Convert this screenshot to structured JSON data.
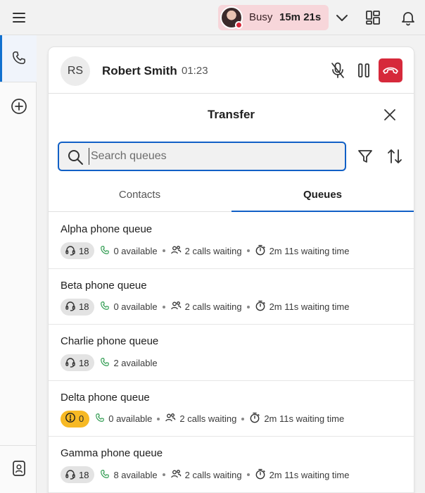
{
  "topbar": {
    "status": {
      "label": "Busy",
      "duration": "15m 21s",
      "color": "#d6293b"
    }
  },
  "call": {
    "initials": "RS",
    "name": "Robert Smith",
    "timer": "01:23"
  },
  "transfer": {
    "title": "Transfer",
    "search_placeholder": "Search queues",
    "tabs": [
      {
        "label": "Contacts",
        "active": false
      },
      {
        "label": "Queues",
        "active": true
      }
    ]
  },
  "queues": [
    {
      "name": "Alpha phone queue",
      "agents": "18",
      "warning": false,
      "available": "0 available",
      "waiting": "2 calls waiting",
      "wait_time": "2m 11s waiting time"
    },
    {
      "name": "Beta phone queue",
      "agents": "18",
      "warning": false,
      "available": "0 available",
      "waiting": "2 calls waiting",
      "wait_time": "2m 11s waiting time"
    },
    {
      "name": "Charlie phone queue",
      "agents": "18",
      "warning": false,
      "available": "2 available",
      "waiting": "",
      "wait_time": ""
    },
    {
      "name": "Delta phone queue",
      "agents": "0",
      "warning": true,
      "available": "0 available",
      "waiting": "2 calls waiting",
      "wait_time": "2m 11s waiting time"
    },
    {
      "name": "Gamma phone queue",
      "agents": "18",
      "warning": false,
      "available": "8 available",
      "waiting": "2 calls waiting",
      "wait_time": "2m 11s waiting time"
    }
  ],
  "colors": {
    "accent": "#1160c6",
    "end_call": "#d6293b",
    "busy_pill": "#f7d6da",
    "warning": "#f7b924",
    "available_phone": "#2e9b4f"
  }
}
